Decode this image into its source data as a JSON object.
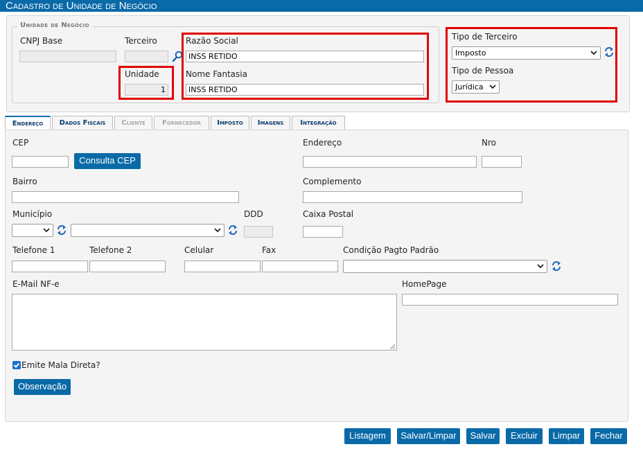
{
  "window": {
    "title": "Cadastro de Unidade de Negócio"
  },
  "header_panel": {
    "legend": "Unidade de Negócio",
    "cnpj_base": {
      "label": "CNPJ Base",
      "value": ""
    },
    "terceiro": {
      "label": "Terceiro",
      "value": ""
    },
    "unidade": {
      "label": "Unidade",
      "value": "1"
    },
    "razao_social": {
      "label": "Razão Social",
      "value": "INSS RETIDO"
    },
    "nome_fantasia": {
      "label": "Nome Fantasia",
      "value": "INSS RETIDO"
    },
    "tipo_terceiro": {
      "label": "Tipo de Terceiro",
      "value": "Imposto"
    },
    "tipo_pessoa": {
      "label": "Tipo de Pessoa",
      "value": "Jurídica"
    }
  },
  "tabs": [
    {
      "label": "Endereço",
      "state": "active"
    },
    {
      "label": "Dados Fiscais",
      "state": "enabled"
    },
    {
      "label": "Cliente",
      "state": "disabled"
    },
    {
      "label": "Fornecedor",
      "state": "disabled"
    },
    {
      "label": "Imposto",
      "state": "enabled"
    },
    {
      "label": "Imagens",
      "state": "enabled"
    },
    {
      "label": "Integração",
      "state": "enabled"
    }
  ],
  "form": {
    "cep": {
      "label": "CEP",
      "value": ""
    },
    "consulta_cep_button": "Consulta CEP",
    "endereco": {
      "label": "Endereço",
      "value": ""
    },
    "nro": {
      "label": "Nro",
      "value": ""
    },
    "bairro": {
      "label": "Bairro",
      "value": ""
    },
    "complemento": {
      "label": "Complemento",
      "value": ""
    },
    "municipio": {
      "label": "Município",
      "uf_value": "",
      "city_value": ""
    },
    "ddd": {
      "label": "DDD",
      "value": ""
    },
    "caixa_postal": {
      "label": "Caixa Postal",
      "value": ""
    },
    "telefone1": {
      "label": "Telefone 1",
      "value": ""
    },
    "telefone2": {
      "label": "Telefone 2",
      "value": ""
    },
    "celular": {
      "label": "Celular",
      "value": ""
    },
    "fax": {
      "label": "Fax",
      "value": ""
    },
    "condicao_pagto": {
      "label": "Condição Pagto Padrão",
      "value": ""
    },
    "email_nfe": {
      "label": "E-Mail NF-e",
      "value": ""
    },
    "homepage": {
      "label": "HomePage",
      "value": ""
    },
    "emite_mala_direta": {
      "label": "Emite Mala Direta?",
      "checked": true
    },
    "observacao_button": "Observação"
  },
  "footer_buttons": {
    "listagem": "Listagem",
    "salvar_limpar": "Salvar/Limpar",
    "salvar": "Salvar",
    "excluir": "Excluir",
    "limpar": "Limpar",
    "fechar": "Fechar"
  },
  "colors": {
    "accent": "#0a6aa8",
    "highlight_border": "#e00000",
    "panel_bg": "#f4f4f4"
  }
}
